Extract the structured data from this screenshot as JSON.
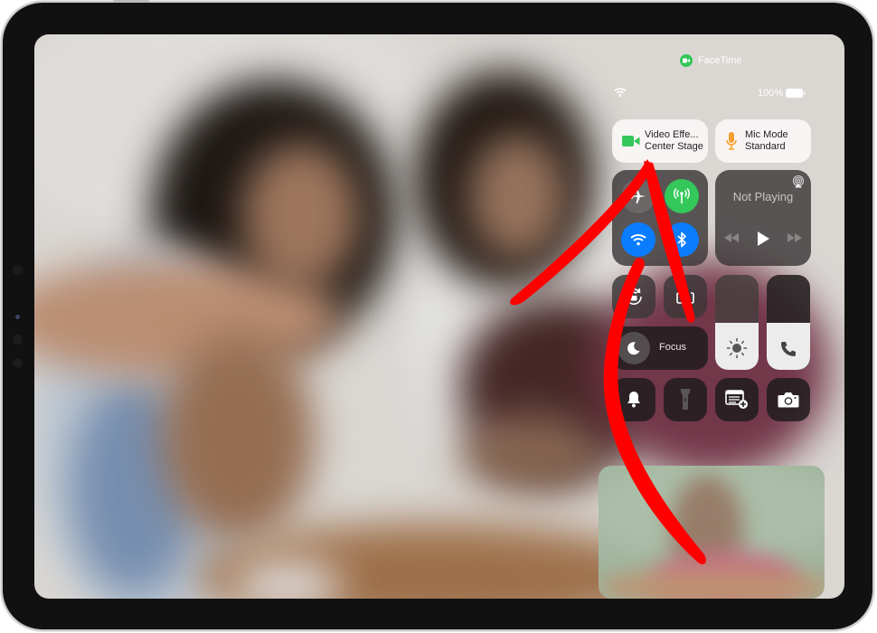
{
  "status_bar": {
    "app_indicator": "FaceTime",
    "battery": "100%",
    "wifi_icon": "wifi-icon",
    "battery_icon": "battery-icon"
  },
  "control_center": {
    "video_effects": {
      "title": "Video Effe...",
      "subtitle": "Center Stage",
      "icon": "video-camera-icon"
    },
    "mic_mode": {
      "title": "Mic Mode",
      "subtitle": "Standard",
      "icon": "microphone-icon"
    },
    "connectivity": {
      "airplane_mode": {
        "icon": "airplane-icon",
        "on": false
      },
      "cellular": {
        "icon": "cellular-antenna-icon",
        "on": true
      },
      "wifi": {
        "icon": "wifi-icon",
        "on": true
      },
      "bluetooth": {
        "icon": "bluetooth-icon",
        "on": true
      }
    },
    "now_playing": {
      "status": "Not Playing",
      "icon": "airplay-audio-icon"
    },
    "focus": {
      "label": "Focus",
      "icon": "moon-icon"
    },
    "brightness": {
      "level": 0.5,
      "icon": "sun-icon"
    },
    "volume": {
      "level": 0.5,
      "icon": "phone-icon"
    },
    "bottom_row": [
      "bell-icon",
      "flashlight-icon",
      "quick-note-icon",
      "camera-icon"
    ]
  },
  "colors": {
    "facetime_green": "#34c759",
    "accent_blue": "#0a7cff",
    "mic_orange": "#f7a130",
    "annotation_red": "#ff0000"
  }
}
